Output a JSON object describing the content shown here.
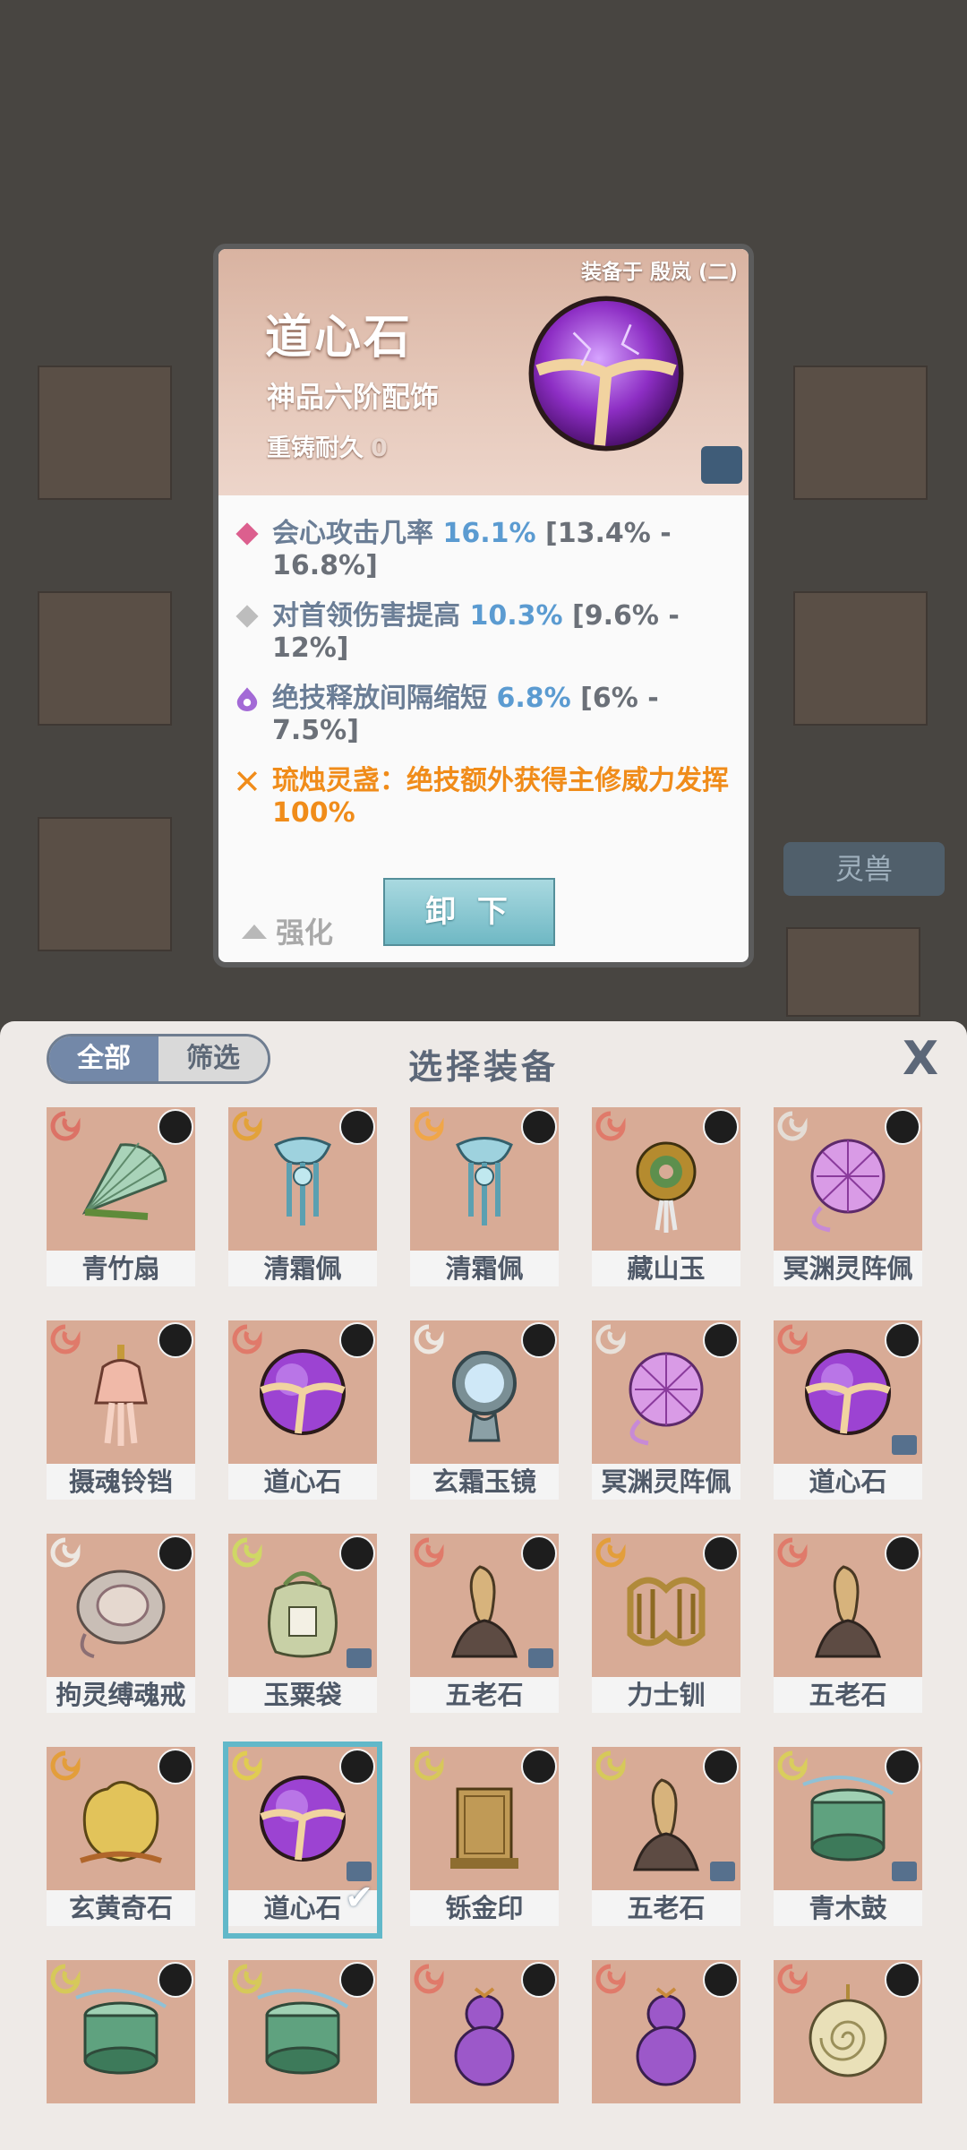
{
  "detail": {
    "equipped_label": "装备于 殷岚 (二)",
    "name": "道心石",
    "grade": "神品六阶配饰",
    "recast_label": "重铸耐久",
    "recast_value": "0",
    "stats": [
      {
        "label": "会心攻击几率",
        "value": "16.1%",
        "range": "[13.4% - 16.8%]"
      },
      {
        "label": "对首领伤害提高",
        "value": "10.3%",
        "range": "[9.6% - 12%]"
      },
      {
        "label": "绝技释放间隔缩短",
        "value": "6.8%",
        "range": "[6% - 7.5%]"
      }
    ],
    "special": "琉烛灵盏：绝技额外获得主修威力发挥100%",
    "enhance_label": "强化",
    "unload_label": "卸 下"
  },
  "background": {
    "tab_label": "灵兽"
  },
  "panel": {
    "title": "选择装备",
    "filter_all": "全部",
    "filter_screen": "筛选",
    "close_glyph": "X",
    "items": [
      {
        "name": "青竹扇",
        "art": "fan",
        "color": "#dc7266",
        "lock": false
      },
      {
        "name": "清霜佩",
        "art": "pendant",
        "color": "#e2a23a",
        "lock": false
      },
      {
        "name": "清霜佩",
        "art": "pendant",
        "color": "#f0a648",
        "lock": false
      },
      {
        "name": "藏山玉",
        "art": "jade",
        "color": "#e07a6a",
        "lock": false
      },
      {
        "name": "冥渊灵阵佩",
        "art": "web",
        "color": "#e4ddd6",
        "lock": false
      },
      {
        "name": "摄魂铃铛",
        "art": "bell",
        "color": "#e07a6a",
        "lock": false
      },
      {
        "name": "道心石",
        "art": "orb",
        "color": "#e07a6a",
        "lock": false
      },
      {
        "name": "玄霜玉镜",
        "art": "mirror",
        "color": "#ede8e2",
        "lock": false
      },
      {
        "name": "冥渊灵阵佩",
        "art": "web",
        "color": "#e8e1da",
        "lock": false
      },
      {
        "name": "道心石",
        "art": "orb",
        "color": "#e07a6a",
        "lock": true
      },
      {
        "name": "拘灵缚魂戒",
        "art": "ring",
        "color": "#ede8e2",
        "lock": false
      },
      {
        "name": "玉粟袋",
        "art": "bag",
        "color": "#cfd765",
        "lock": true
      },
      {
        "name": "五老石",
        "art": "stone",
        "color": "#e07a6a",
        "lock": true
      },
      {
        "name": "力士钏",
        "art": "bracelet",
        "color": "#e39e3b",
        "lock": false
      },
      {
        "name": "五老石",
        "art": "stone",
        "color": "#e07a6a",
        "lock": false
      },
      {
        "name": "玄黄奇石",
        "art": "rock",
        "color": "#e39e3b",
        "lock": false
      },
      {
        "name": "道心石",
        "art": "orb",
        "color": "#e0cc52",
        "lock": true
      },
      {
        "name": "铄金印",
        "art": "seal",
        "color": "#d7c75a",
        "lock": false
      },
      {
        "name": "五老石",
        "art": "stone",
        "color": "#d6c95a",
        "lock": true
      },
      {
        "name": "青木鼓",
        "art": "drum",
        "color": "#d9cd5d",
        "lock": true
      },
      {
        "name": "",
        "art": "drum",
        "color": "#d6c95a",
        "lock": false
      },
      {
        "name": "",
        "art": "drum",
        "color": "#d6c95a",
        "lock": false
      },
      {
        "name": "",
        "art": "gourd",
        "color": "#e07a6a",
        "lock": false
      },
      {
        "name": "",
        "art": "gourd",
        "color": "#e07a6a",
        "lock": false
      },
      {
        "name": "",
        "art": "coil",
        "color": "#e07a6a",
        "lock": false
      }
    ],
    "selected_index": 16
  }
}
